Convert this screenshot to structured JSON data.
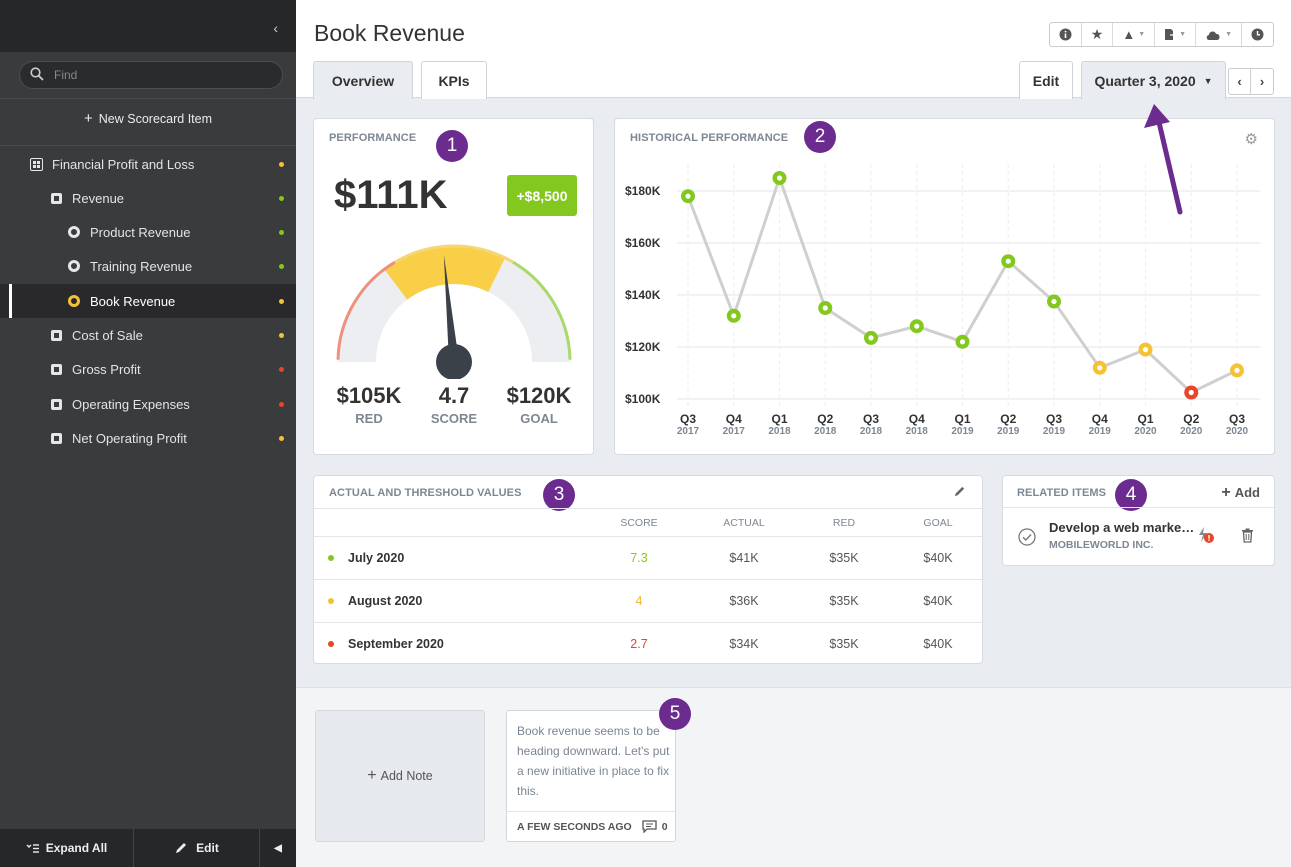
{
  "sidebar": {
    "search_placeholder": "Find",
    "new_item_label": "New Scorecard Item",
    "items": [
      {
        "label": "Financial Profit and Loss",
        "icon": "scorecard-icon",
        "status": "#f6c233"
      },
      {
        "label": "Revenue",
        "icon": "objective-icon",
        "status": "#83c81e"
      },
      {
        "label": "Product Revenue",
        "icon": "measure-icon",
        "status": "#83c81e"
      },
      {
        "label": "Training Revenue",
        "icon": "measure-icon",
        "status": "#83c81e"
      },
      {
        "label": "Book Revenue",
        "icon": "measure-icon",
        "status": "#f6c233",
        "active": true
      },
      {
        "label": "Cost of Sale",
        "icon": "objective-icon",
        "status": "#f6c233"
      },
      {
        "label": "Gross Profit",
        "icon": "objective-icon",
        "status": "#e8452c"
      },
      {
        "label": "Operating Expenses",
        "icon": "objective-icon",
        "status": "#e8452c"
      },
      {
        "label": "Net Operating Profit",
        "icon": "objective-icon",
        "status": "#f6c233"
      }
    ],
    "expand_all_label": "Expand All",
    "edit_label": "Edit"
  },
  "header": {
    "title": "Book Revenue",
    "tabs": [
      "Overview",
      "KPIs"
    ],
    "edit_label": "Edit",
    "period_label": "Quarter 3, 2020"
  },
  "performance": {
    "title": "PERFORMANCE",
    "value": "$111K",
    "delta": "+$8,500",
    "red_value": "$105K",
    "red_label": "RED",
    "score_value": "4.7",
    "score_label": "SCORE",
    "goal_value": "$120K",
    "goal_label": "GOAL",
    "score_fraction": 0.47
  },
  "historical": {
    "title": "HISTORICAL PERFORMANCE"
  },
  "chart_data": {
    "type": "line",
    "title": "HISTORICAL PERFORMANCE",
    "categories": [
      "Q3 2017",
      "Q4 2017",
      "Q1 2018",
      "Q2 2018",
      "Q3 2018",
      "Q4 2018",
      "Q1 2019",
      "Q2 2019",
      "Q3 2019",
      "Q4 2019",
      "Q1 2020",
      "Q2 2020",
      "Q3 2020"
    ],
    "x_quarters": [
      "Q3",
      "Q4",
      "Q1",
      "Q2",
      "Q3",
      "Q4",
      "Q1",
      "Q2",
      "Q3",
      "Q4",
      "Q1",
      "Q2",
      "Q3"
    ],
    "x_years": [
      "2017",
      "2017",
      "2018",
      "2018",
      "2018",
      "2018",
      "2019",
      "2019",
      "2019",
      "2019",
      "2020",
      "2020",
      "2020"
    ],
    "values": [
      178000,
      132000,
      185000,
      135000,
      123500,
      128000,
      122000,
      153000,
      137500,
      112000,
      119000,
      102500,
      111000
    ],
    "point_status": [
      "green",
      "green",
      "green",
      "green",
      "green",
      "green",
      "green",
      "green",
      "green",
      "yellow",
      "yellow",
      "red",
      "yellow"
    ],
    "yticks": [
      "$100K",
      "$120K",
      "$140K",
      "$160K",
      "$180K"
    ],
    "ytick_values": [
      100000,
      120000,
      140000,
      160000,
      180000
    ],
    "ylim": [
      100000,
      180000
    ],
    "grid": true,
    "colors": {
      "green": "#83c81e",
      "yellow": "#f6c233",
      "red": "#e8452c",
      "line": "#cfcfcf"
    }
  },
  "thresholds": {
    "title": "ACTUAL AND THRESHOLD VALUES",
    "headers": [
      "",
      "SCORE",
      "ACTUAL",
      "RED",
      "GOAL"
    ],
    "rows": [
      {
        "period": "July 2020",
        "status": "#83c81e",
        "score": "7.3",
        "actual": "$41K",
        "red": "$35K",
        "goal": "$40K"
      },
      {
        "period": "August 2020",
        "status": "#f6c233",
        "score": "4",
        "actual": "$36K",
        "red": "$35K",
        "goal": "$40K"
      },
      {
        "period": "September 2020",
        "status": "#e8452c",
        "score": "2.7",
        "actual": "$34K",
        "red": "$35K",
        "goal": "$40K"
      }
    ]
  },
  "related": {
    "title": "RELATED ITEMS",
    "add_label": "Add",
    "items": [
      {
        "title": "Develop a web marke…",
        "subtitle": "MOBILEWORLD INC."
      }
    ]
  },
  "notes": {
    "add_label": "Add Note",
    "items": [
      {
        "text": "Book revenue seems to be heading downward. Let's put a new initiative in place to fix this.",
        "time": "A FEW SECONDS AGO",
        "comments": "0"
      }
    ]
  },
  "badges": [
    "1",
    "2",
    "3",
    "4",
    "5"
  ],
  "colors": {
    "accent_purple": "#6c2b8e",
    "green": "#83c81e",
    "yellow": "#f6c233",
    "red": "#e8452c"
  }
}
